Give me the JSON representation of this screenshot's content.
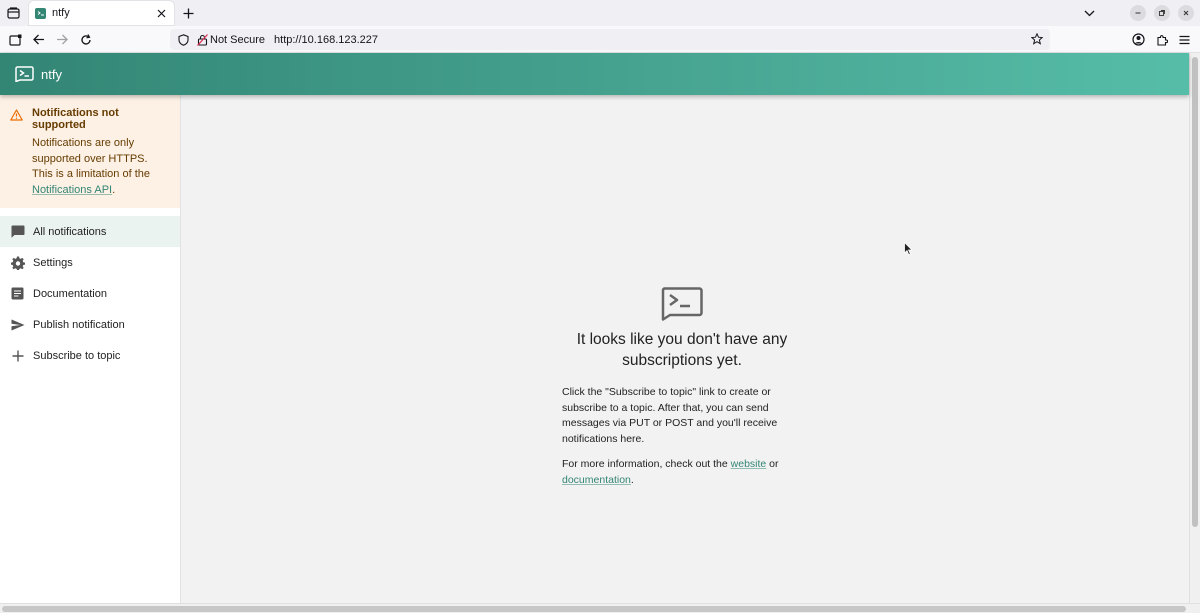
{
  "browser": {
    "tab_title": "ntfy",
    "url_security_label": "Not Secure",
    "url": "http://10.168.123.227"
  },
  "app": {
    "title": "ntfy"
  },
  "sidebar": {
    "alert": {
      "title": "Notifications not supported",
      "body": "Notifications are only supported over HTTPS. This is a limitation of the ",
      "link_text": "Notifications API",
      "suffix": "."
    },
    "items": [
      {
        "label": "All notifications",
        "icon": "chat-bubble-icon",
        "selected": true
      },
      {
        "label": "Settings",
        "icon": "gear-icon"
      },
      {
        "label": "Documentation",
        "icon": "article-icon"
      },
      {
        "label": "Publish notification",
        "icon": "send-icon"
      },
      {
        "label": "Subscribe to topic",
        "icon": "plus-icon"
      }
    ]
  },
  "main": {
    "empty_title": "It looks like you don't have any subscriptions yet.",
    "empty_p1": "Click the \"Subscribe to topic\" link to create or subscribe to a topic. After that, you can send messages via PUT or POST and you'll receive notifications here.",
    "empty_p2_prefix": "For more information, check out the ",
    "website_link": "website",
    "empty_p2_mid": " or ",
    "documentation_link": "documentation",
    "empty_p2_suffix": "."
  },
  "colors": {
    "brand": "#338574",
    "brand_light": "#56bda8",
    "alert_bg": "#fdf1e5",
    "alert_text": "#663c00",
    "warning": "#ed6c02"
  }
}
